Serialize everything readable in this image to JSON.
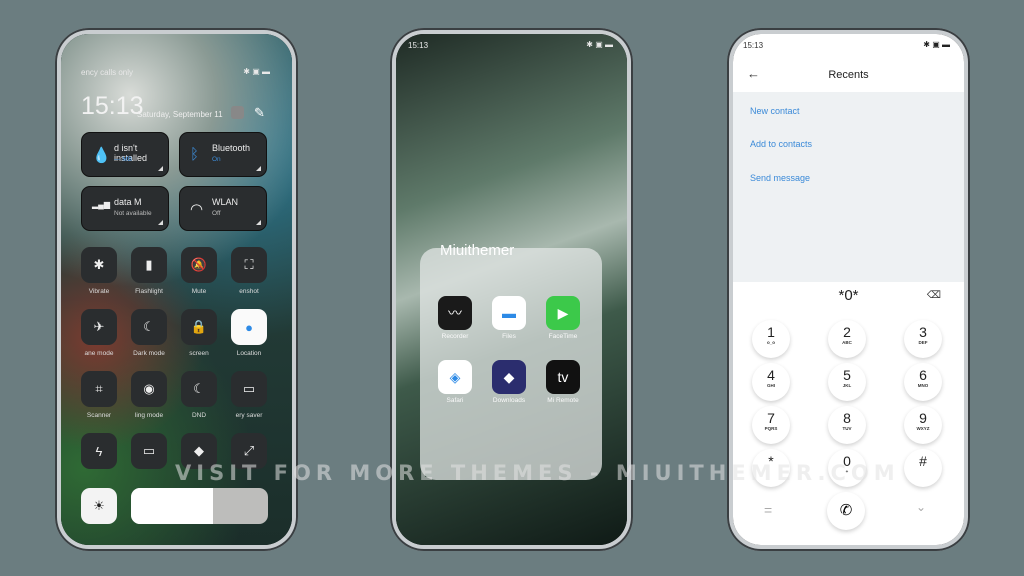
{
  "control_center": {
    "status_text": "ency calls only",
    "clock": "15:13",
    "date": "Saturday, September 11",
    "tiles": [
      {
        "title": "d isn't installed",
        "sub": "— MB",
        "icon": "water-drop"
      },
      {
        "title": "Bluetooth",
        "sub": "On",
        "icon": "bluetooth"
      },
      {
        "title": "data     M",
        "sub": "Not available",
        "icon": "signal"
      },
      {
        "title": "WLAN",
        "sub": "Off",
        "icon": "wifi"
      }
    ],
    "toggles": [
      {
        "label": "Vibrate",
        "icon": "vibrate"
      },
      {
        "label": "Flashlight",
        "icon": "flashlight"
      },
      {
        "label": "Mute",
        "icon": "mute"
      },
      {
        "label": "enshot",
        "icon": "screenshot"
      },
      {
        "label": "ane mode",
        "icon": "airplane"
      },
      {
        "label": "Dark mode",
        "icon": "moon"
      },
      {
        "label": "screen",
        "icon": "lock"
      },
      {
        "label": "Location",
        "icon": "location",
        "active": true
      },
      {
        "label": "Scanner",
        "icon": "scanner"
      },
      {
        "label": "ling mode",
        "icon": "eye"
      },
      {
        "label": "DND",
        "icon": "moon"
      },
      {
        "label": "ery saver",
        "icon": "battery"
      },
      {
        "label": "",
        "icon": "bolt"
      },
      {
        "label": "",
        "icon": "cast"
      },
      {
        "label": "",
        "icon": "shortcut"
      },
      {
        "label": "",
        "icon": "resize"
      }
    ],
    "brightness": 0.6
  },
  "home": {
    "status_time": "15:13",
    "folder_name": "Miuithemer",
    "apps": [
      {
        "label": "Recorder",
        "color": "#1a1a1a",
        "glyph": "〰"
      },
      {
        "label": "Files",
        "color": "#ffffff",
        "glyph": "▬"
      },
      {
        "label": "FaceTime",
        "color": "#3cc94a",
        "glyph": "▶"
      },
      {
        "label": "Safari",
        "color": "#ffffff",
        "glyph": "◈"
      },
      {
        "label": "Downloads",
        "color": "#2b2d6e",
        "glyph": "◆"
      },
      {
        "label": "Mi Remote",
        "color": "#111111",
        "glyph": "tv"
      }
    ]
  },
  "dialer": {
    "status_time": "15:13",
    "title": "Recents",
    "actions": [
      "New contact",
      "Add to contacts",
      "Send message"
    ],
    "input": "*0*",
    "keys": [
      {
        "n": "1",
        "l": "o_o"
      },
      {
        "n": "2",
        "l": "ABC"
      },
      {
        "n": "3",
        "l": "DEF"
      },
      {
        "n": "4",
        "l": "GHI"
      },
      {
        "n": "5",
        "l": "JKL"
      },
      {
        "n": "6",
        "l": "MNO"
      },
      {
        "n": "7",
        "l": "PQRS"
      },
      {
        "n": "8",
        "l": "TUV"
      },
      {
        "n": "9",
        "l": "WXYZ"
      },
      {
        "n": "*",
        "l": ""
      },
      {
        "n": "0",
        "l": "+"
      },
      {
        "n": "#",
        "l": ""
      }
    ]
  },
  "watermark": "VISIT FOR MORE THEMES - MIUITHEMER.COM"
}
